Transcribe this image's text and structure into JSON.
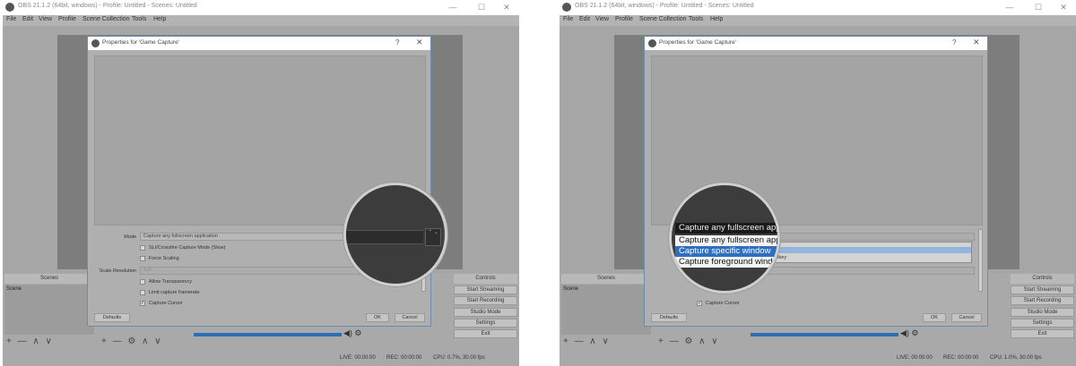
{
  "left": {
    "window": {
      "title": "OBS 21.1.2 (64bit, windows) - Profile: Untitled - Scenes: Untitled",
      "min": "—",
      "max": "☐",
      "close": "✕"
    },
    "menu": [
      "File",
      "Edit",
      "View",
      "Profile",
      "Scene Collection",
      "Tools",
      "Help"
    ],
    "docks": {
      "scenes": "Scenes",
      "controls": "Controls",
      "scene_item": "Scene"
    },
    "dock_buttons": {
      "scenes": "+ — ∧ ∨",
      "sources": "+ — ⚙ ∧ ∨"
    },
    "controls": [
      "Start Streaming",
      "Start Recording",
      "Studio Mode",
      "Settings",
      "Exit"
    ],
    "mixer_icons": "◀) ⚙",
    "status": {
      "live": "LIVE: 00:00:00",
      "rec": "REC: 00:00:00",
      "cpu": "CPU: 0.7%, 30.00 fps"
    },
    "dialog": {
      "title": "Properties for 'Game Capture'",
      "help": "?",
      "close": "✕",
      "mode_label": "Mode",
      "mode_value": "Capture any fullscreen application",
      "sli": "SLI/Crossfire Capture Mode (Slow)",
      "force_scaling": "Force Scaling",
      "scale_label": "Scale Resolution",
      "scale_value": "1x0",
      "allow_transparency": "Allow Transparency",
      "limit_framerate": "Limit capture framerate",
      "capture_cursor": "Capture Cursor",
      "check_mark": "✓",
      "defaults": "Defaults",
      "ok": "OK",
      "cancel": "Cancel"
    },
    "magnifier": {
      "stepper": "⌃\n⌄"
    }
  },
  "right": {
    "window": {
      "title": "OBS 21.1.2 (64bit, windows) - Profile: Untitled - Scenes: Untitled",
      "min": "—",
      "max": "☐",
      "close": "✕"
    },
    "menu": [
      "File",
      "Edit",
      "View",
      "Profile",
      "Scene Collection",
      "Tools",
      "Help"
    ],
    "docks": {
      "scenes": "Scenes",
      "controls": "Controls",
      "scene_item": "Scene"
    },
    "dock_buttons": {
      "scenes": "+ — ∧ ∨",
      "sources": "+ — ⚙ ∧ ∨"
    },
    "controls": [
      "Start Streaming",
      "Start Recording",
      "Studio Mode",
      "Settings",
      "Exit"
    ],
    "mixer_icons": "◀) ⚙",
    "status": {
      "live": "LIVE: 00:00:00",
      "rec": "REC: 00:00:00",
      "cpu": "CPU: 1.0%, 30.00 fps"
    },
    "dialog": {
      "title": "Properties for 'Game Capture'",
      "help": "?",
      "close": "✕",
      "capture_cursor": "Capture Cursor",
      "check_mark": "✓",
      "hotkey_partial": "tkey",
      "defaults": "Defaults",
      "ok": "OK",
      "cancel": "Cancel"
    },
    "mode_options": [
      "Capture any fullscreen application",
      "Capture any fullscreen application",
      "Capture specific window",
      "Capture foreground window with hotkey"
    ],
    "selected_option": "Capture specific window"
  },
  "colors": {
    "accent": "#2f6fc0",
    "dialog_border": "#6d8cb0",
    "highlight": "#94b4dc"
  }
}
